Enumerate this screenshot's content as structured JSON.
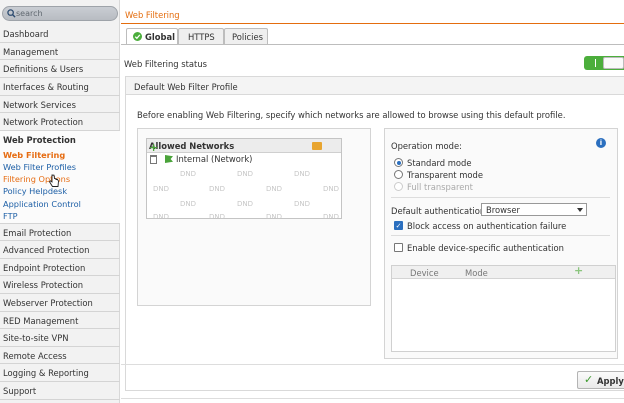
{
  "sidebar": {
    "search_placeholder": "search",
    "items": [
      {
        "label": "Dashboard"
      },
      {
        "label": "Management"
      },
      {
        "label": "Definitions & Users"
      },
      {
        "label": "Interfaces & Routing"
      },
      {
        "label": "Network Services"
      },
      {
        "label": "Network Protection"
      },
      {
        "label": "Web Protection"
      },
      {
        "label": "Email Protection"
      },
      {
        "label": "Advanced Protection"
      },
      {
        "label": "Endpoint Protection"
      },
      {
        "label": "Wireless Protection"
      },
      {
        "label": "Webserver Protection"
      },
      {
        "label": "RED Management"
      },
      {
        "label": "Site-to-site VPN"
      },
      {
        "label": "Remote Access"
      },
      {
        "label": "Logging & Reporting"
      },
      {
        "label": "Support"
      }
    ],
    "web_protection_sub": [
      {
        "label": "Web Filtering"
      },
      {
        "label": "Web Filter Profiles"
      },
      {
        "label": "Filtering Options"
      },
      {
        "label": "Policy Helpdesk"
      },
      {
        "label": "Application Control"
      },
      {
        "label": "FTP"
      }
    ]
  },
  "header": {
    "title": "Web Filtering"
  },
  "tabs": [
    {
      "label": "Global"
    },
    {
      "label": "HTTPS"
    },
    {
      "label": "Policies"
    }
  ],
  "status": {
    "label": "Web Filtering status",
    "enabled": true
  },
  "profile": {
    "title": "Default Web Filter Profile",
    "intro": "Before enabling Web Filtering, specify which networks are allowed to browse using this default profile.",
    "allowed_networks": {
      "title": "Allowed Networks",
      "items": [
        {
          "name": "Internal (Network)"
        }
      ],
      "dnd": "DND"
    },
    "operation_mode": {
      "label": "Operation mode:",
      "options": [
        {
          "label": "Standard mode",
          "selected": true
        },
        {
          "label": "Transparent mode",
          "selected": false
        },
        {
          "label": "Full transparent",
          "selected": false,
          "disabled": true
        }
      ]
    },
    "default_auth": {
      "label": "Default authentication:",
      "value": "Browser"
    },
    "block_access": {
      "label": "Block access on authentication failure",
      "checked": true
    },
    "device_auth": {
      "label": "Enable device-specific authentication",
      "checked": false
    },
    "device_table": {
      "columns": [
        "Device",
        "Mode"
      ]
    }
  },
  "footer": {
    "apply_label": "Apply"
  },
  "colors": {
    "accent": "#e46d0e",
    "link": "#1d5fa6",
    "ok": "#4cae3c"
  }
}
